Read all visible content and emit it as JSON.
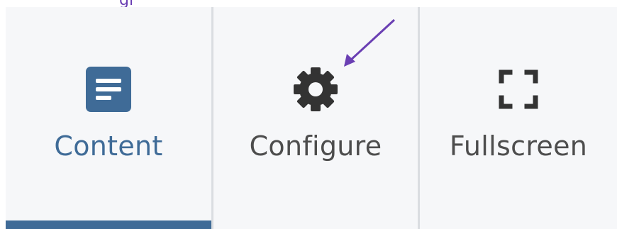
{
  "top_hint": "gi",
  "toolbar": {
    "tabs": [
      {
        "id": "content",
        "label": "Content",
        "icon": "document-list-icon",
        "active": true
      },
      {
        "id": "configure",
        "label": "Configure",
        "icon": "gear-icon",
        "active": false
      },
      {
        "id": "fullscreen",
        "label": "Fullscreen",
        "icon": "expand-icon",
        "active": false
      }
    ]
  },
  "colors": {
    "accent": "#3f6b97",
    "icon_dark": "#333333",
    "label_dark": "#4d4d4d",
    "background": "#f6f7f9",
    "divider": "#dadde1",
    "annotation_arrow": "#6a3fb3"
  }
}
